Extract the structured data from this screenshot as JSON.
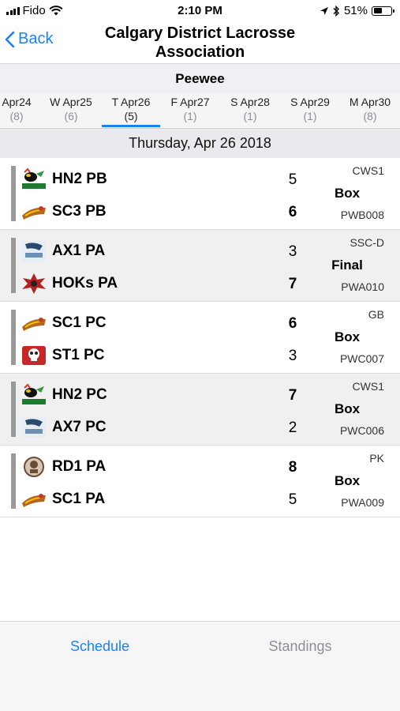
{
  "status_bar": {
    "carrier": "Fido",
    "time": "2:10 PM",
    "battery_percent": "51%",
    "battery_level": 0.51,
    "icons": [
      "signal-bars-icon",
      "wifi-icon",
      "location-arrow-icon",
      "bluetooth-icon",
      "battery-icon"
    ]
  },
  "nav": {
    "back_label": "Back",
    "title_line1": "Calgary District Lacrosse",
    "title_line2": "Association"
  },
  "division": "Peewee",
  "days": [
    {
      "label": "Apr24",
      "count": "(8)"
    },
    {
      "label": "W Apr25",
      "count": "(6)"
    },
    {
      "label": "T Apr26",
      "count": "(5)",
      "selected": true
    },
    {
      "label": "F Apr27",
      "count": "(1)"
    },
    {
      "label": "S Apr28",
      "count": "(1)"
    },
    {
      "label": "S Apr29",
      "count": "(1)"
    },
    {
      "label": "M Apr30",
      "count": "(8)"
    }
  ],
  "date_header": "Thursday, Apr 26 2018",
  "games": [
    {
      "team1": "HN2 PB",
      "score1": "5",
      "team2": "SC3 PB",
      "score2": "6",
      "location": "CWS1",
      "type": "Box",
      "code": "PWB008",
      "winner": 2,
      "logo1": "hornets-logo-icon",
      "logo2": "saints-logo-icon"
    },
    {
      "team1": "AX1 PA",
      "score1": "3",
      "team2": "HOKs PA",
      "score2": "7",
      "location": "SSC-D",
      "type": "Final",
      "code": "PWA010",
      "winner": 2,
      "logo1": "axemen-logo-icon",
      "logo2": "hoks-logo-icon"
    },
    {
      "team1": "SC1 PC",
      "score1": "6",
      "team2": "ST1 PC",
      "score2": "3",
      "location": "GB",
      "type": "Box",
      "code": "PWC007",
      "winner": 1,
      "logo1": "saints-logo-icon",
      "logo2": "skull-logo-icon"
    },
    {
      "team1": "HN2 PC",
      "score1": "7",
      "team2": "AX7 PC",
      "score2": "2",
      "location": "CWS1",
      "type": "Box",
      "code": "PWC006",
      "winner": 1,
      "logo1": "hornets-logo-icon",
      "logo2": "axemen-logo-icon"
    },
    {
      "team1": "RD1  PA",
      "score1": "8",
      "team2": "SC1 PA",
      "score2": "5",
      "location": "PK",
      "type": "Box",
      "code": "PWA009",
      "winner": 1,
      "logo1": "raiders-logo-icon",
      "logo2": "saints-logo-icon"
    }
  ],
  "tabs": {
    "schedule": "Schedule",
    "standings": "Standings"
  },
  "colors": {
    "accent": "#1a82f7",
    "inactive": "#8e8e93"
  }
}
